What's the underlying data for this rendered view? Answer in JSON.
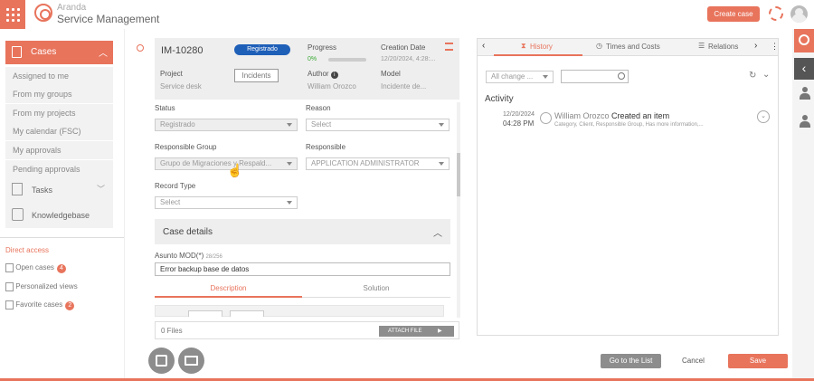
{
  "app": {
    "brand_top": "Aranda",
    "brand_bottom": "Service Management",
    "create_case": "Create case"
  },
  "sidebar": {
    "cases": "Cases",
    "items": [
      "Assigned to me",
      "From my groups",
      "From my projects",
      "My calendar (FSC)",
      "My approvals",
      "Pending approvals"
    ],
    "tasks": "Tasks",
    "knowledgebase": "Knowledgebase",
    "direct_access": "Direct access",
    "open_cases": "Open cases",
    "open_cases_count": "4",
    "personalized_views": "Personalized views",
    "favorite_cases": "Favorite cases",
    "favorite_cases_count": "2"
  },
  "case": {
    "id": "IM-10280",
    "state_badge": "Registrado",
    "progress_label": "Progress",
    "progress_value": "0%",
    "progress_fraction": 0,
    "creation_label": "Creation Date",
    "creation_value": "12/20/2024, 4:28:...",
    "project_label": "Project",
    "project_value": "Service desk",
    "type_button": "Incidents",
    "author_label": "Author",
    "author_value": "William Orozco",
    "model_label": "Model",
    "model_value": "Incidente de..."
  },
  "form": {
    "status_label": "Status",
    "status_value": "Registrado",
    "reason_label": "Reason",
    "reason_value": "Select",
    "group_label": "Responsible Group",
    "group_value": "Grupo de Migraciones y Respald...",
    "responsible_label": "Responsible",
    "responsible_value": "APPLICATION ADMINISTRATOR",
    "record_type_label": "Record Type",
    "record_type_value": "Select",
    "case_details": "Case details",
    "subject_label": "Asunto MOD(*)",
    "subject_counter": "28/256",
    "subject_value": "Error backup base de datos",
    "tab_description": "Description",
    "tab_solution": "Solution",
    "files": "0 Files",
    "attach": "ATTACH FILE"
  },
  "history": {
    "tab_history": "History",
    "tab_times": "Times and Costs",
    "tab_relations": "Relations",
    "filter_placeholder": "All change ...",
    "activity_title": "Activity",
    "entry_date": "12/20/2024",
    "entry_time": "04:28 PM",
    "entry_user": "William Orozco",
    "entry_action": "Created an item",
    "entry_detail": "Category, Client, Responsible Group, Has more information,..."
  },
  "actions": {
    "go_list": "Go to the List",
    "cancel": "Cancel",
    "save": "Save"
  },
  "colors": {
    "accent": "#e8745c",
    "badge_blue": "#1e5fb8",
    "progress_green": "#3aaa35"
  }
}
